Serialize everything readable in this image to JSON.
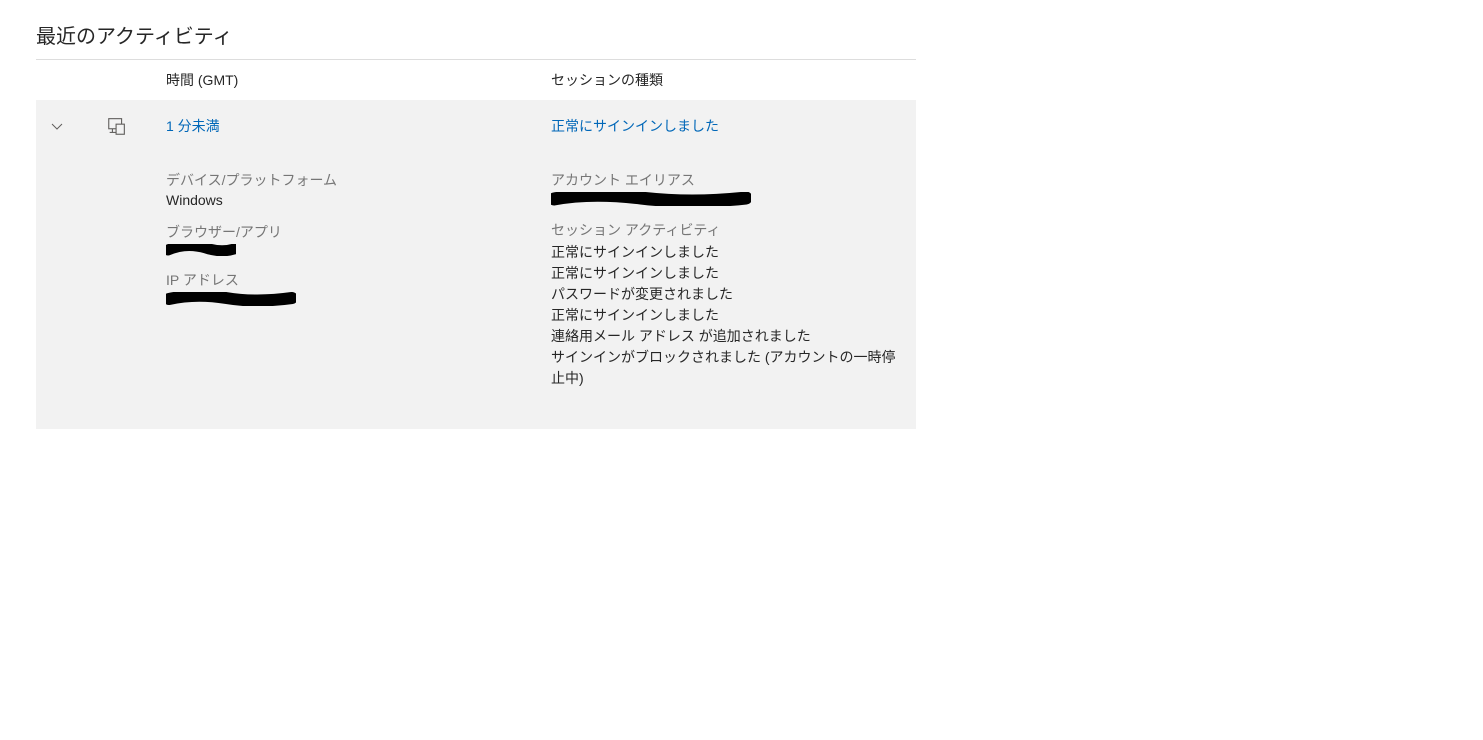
{
  "section_title": "最近のアクティビティ",
  "headers": {
    "time": "時間 (GMT)",
    "session": "セッションの種類"
  },
  "row": {
    "time": "1 分未満",
    "session": "正常にサインインしました"
  },
  "details": {
    "device_label": "デバイス/プラットフォーム",
    "device_value": "Windows",
    "browser_label": "ブラウザー/アプリ",
    "ip_label": "IP アドレス",
    "alias_label": "アカウント エイリアス",
    "activity_label": "セッション アクティビティ",
    "activities": {
      "0": "正常にサインインしました",
      "1": "正常にサインインしました",
      "2": "パスワードが変更されました",
      "3": "正常にサインインしました",
      "4": "連絡用メール アドレス が追加されました",
      "5": "サインインがブロックされました (アカウントの一時停止中)"
    }
  }
}
